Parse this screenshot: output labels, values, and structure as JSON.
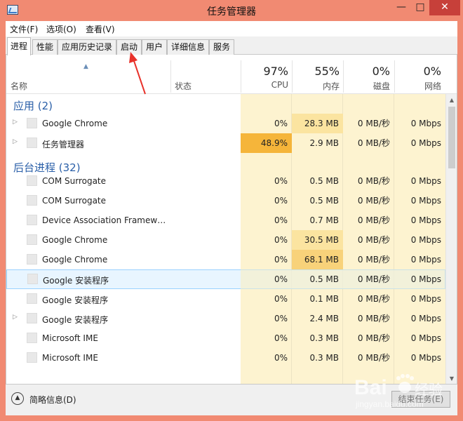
{
  "window": {
    "title": "任务管理器",
    "controls": {
      "minimize": "—",
      "maximize": "□",
      "close": "✕"
    }
  },
  "menu": [
    {
      "label": "文件(F)"
    },
    {
      "label": "选项(O)"
    },
    {
      "label": "查看(V)"
    }
  ],
  "tabs": [
    {
      "label": "进程",
      "active": true
    },
    {
      "label": "性能"
    },
    {
      "label": "应用历史记录"
    },
    {
      "label": "启动"
    },
    {
      "label": "用户"
    },
    {
      "label": "详细信息"
    },
    {
      "label": "服务"
    }
  ],
  "columns": {
    "name": "名称",
    "status": "状态",
    "cpu": {
      "pct": "97%",
      "label": "CPU"
    },
    "memory": {
      "pct": "55%",
      "label": "内存"
    },
    "disk": {
      "pct": "0%",
      "label": "磁盘"
    },
    "network": {
      "pct": "0%",
      "label": "网络"
    }
  },
  "groups": {
    "apps": "应用 (2)",
    "background": "后台进程 (32)"
  },
  "rows": [
    {
      "name": "Google Chrome",
      "cpu": "0%",
      "mem": "28.3 MB",
      "disk": "0 MB/秒",
      "net": "0 Mbps"
    },
    {
      "name": "任务管理器",
      "cpu": "48.9%",
      "mem": "2.9 MB",
      "disk": "0 MB/秒",
      "net": "0 Mbps"
    },
    {
      "name": "COM Surrogate",
      "cpu": "0%",
      "mem": "0.5 MB",
      "disk": "0 MB/秒",
      "net": "0 Mbps"
    },
    {
      "name": "COM Surrogate",
      "cpu": "0%",
      "mem": "0.5 MB",
      "disk": "0 MB/秒",
      "net": "0 Mbps"
    },
    {
      "name": "Device Association Framewo...",
      "cpu": "0%",
      "mem": "0.7 MB",
      "disk": "0 MB/秒",
      "net": "0 Mbps"
    },
    {
      "name": "Google Chrome",
      "cpu": "0%",
      "mem": "30.5 MB",
      "disk": "0 MB/秒",
      "net": "0 Mbps"
    },
    {
      "name": "Google Chrome",
      "cpu": "0%",
      "mem": "68.1 MB",
      "disk": "0 MB/秒",
      "net": "0 Mbps"
    },
    {
      "name": "Google 安装程序",
      "cpu": "0%",
      "mem": "0.5 MB",
      "disk": "0 MB/秒",
      "net": "0 Mbps"
    },
    {
      "name": "Google 安装程序",
      "cpu": "0%",
      "mem": "0.1 MB",
      "disk": "0 MB/秒",
      "net": "0 Mbps"
    },
    {
      "name": "Google 安装程序",
      "cpu": "0%",
      "mem": "2.4 MB",
      "disk": "0 MB/秒",
      "net": "0 Mbps"
    },
    {
      "name": "Microsoft IME",
      "cpu": "0%",
      "mem": "0.3 MB",
      "disk": "0 MB/秒",
      "net": "0 Mbps"
    },
    {
      "name": "Microsoft IME",
      "cpu": "0%",
      "mem": "0.3 MB",
      "disk": "0 MB/秒",
      "net": "0 Mbps"
    }
  ],
  "footer": {
    "fewer_details": "简略信息(D)",
    "end_task": "结束任务(E)"
  },
  "icons": {
    "expand": "expand-arrow-icon",
    "sort": "sort-ascending-icon",
    "fewer": "chevron-up-icon"
  },
  "colors": {
    "title_bar": "#f18a72",
    "close_button": "#c7403a",
    "group_label": "#2a5fa8",
    "cpu_hot": "#f5b53a",
    "column_heat": "#fdf3d0",
    "annotation_arrow": "#e8312a"
  },
  "watermark": {
    "brand": "Bai",
    "brand_suffix": "经验",
    "url": "jingyan.baidu.com"
  }
}
